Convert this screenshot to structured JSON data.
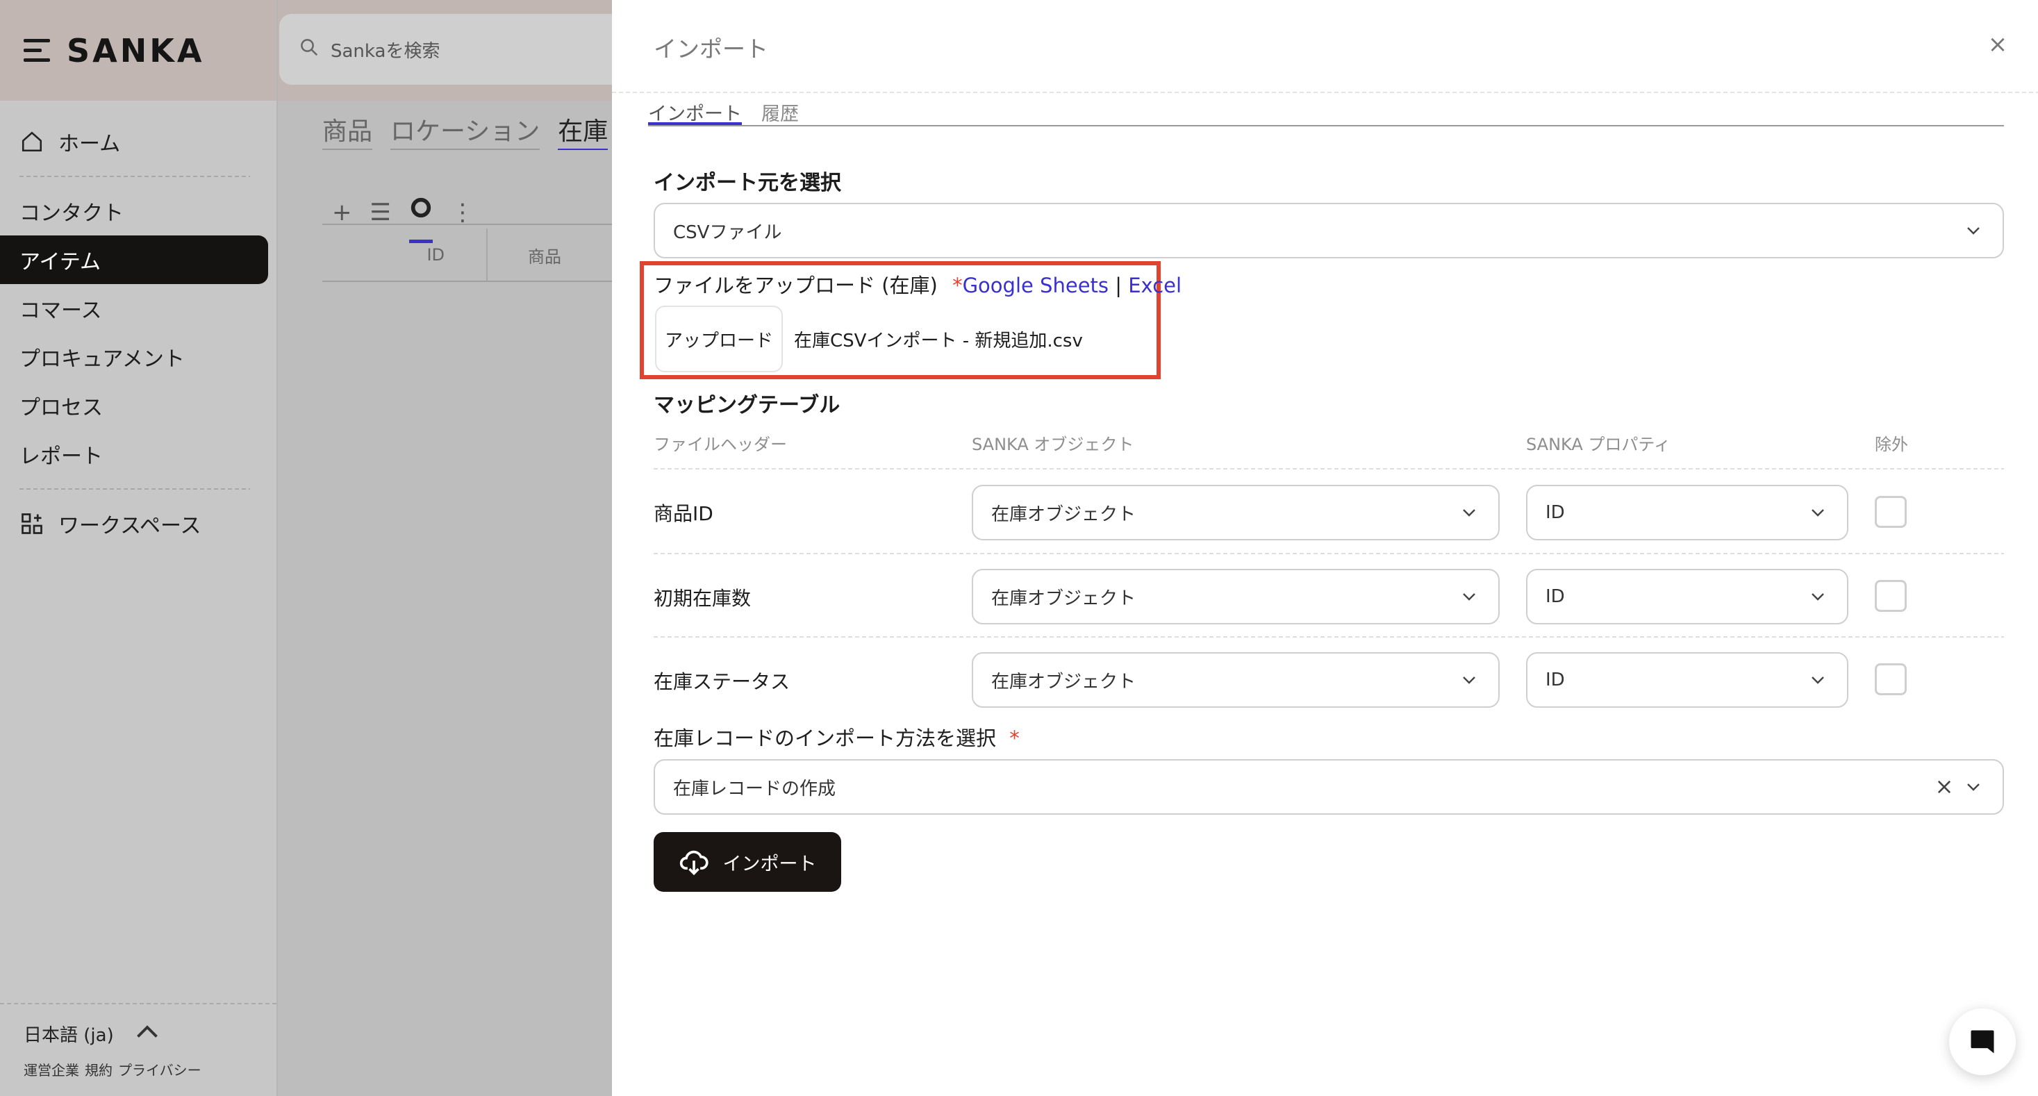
{
  "app": {
    "brand": "SANKA",
    "search_placeholder": "Sankaを検索",
    "nav": {
      "home": "ホーム",
      "contact": "コンタクト",
      "item": "アイテム",
      "commerce": "コマース",
      "procurement": "プロキュアメント",
      "process": "プロセス",
      "report": "レポート",
      "workspace": "ワークスペース"
    },
    "language": "日本語 (ja)",
    "footer_links": [
      "運営企業",
      "規約",
      "プライバシー"
    ],
    "main_tabs": [
      "商品",
      "ロケーション",
      "在庫"
    ],
    "table_headers": [
      "ID",
      "商品"
    ]
  },
  "panel": {
    "title": "インポート",
    "close": "×",
    "tabs": [
      "インポート",
      "履歴"
    ],
    "source_label": "インポート元を選択",
    "source_value": "CSVファイル",
    "upload": {
      "label": "ファイルをアップロード (在庫)",
      "required_mark": "*",
      "google_sheets": "Google Sheets",
      "separator": "|",
      "excel": "Excel",
      "button": "アップロード",
      "file_name": "在庫CSVインポート - 新規追加.csv"
    },
    "mapping": {
      "title": "マッピングテーブル",
      "headers": [
        "ファイルヘッダー",
        "SANKA オブジェクト",
        "SANKA プロパティ",
        "除外"
      ],
      "rows": [
        {
          "header": "商品ID",
          "object": "在庫オブジェクト",
          "property": "ID",
          "excluded": false
        },
        {
          "header": "初期在庫数",
          "object": "在庫オブジェクト",
          "property": "ID",
          "excluded": false
        },
        {
          "header": "在庫ステータス",
          "object": "在庫オブジェクト",
          "property": "ID",
          "excluded": false
        }
      ]
    },
    "method": {
      "label": "在庫レコードのインポート方法を選択",
      "required_mark": "*",
      "value": "在庫レコードの作成"
    },
    "import_button": "インポート"
  }
}
